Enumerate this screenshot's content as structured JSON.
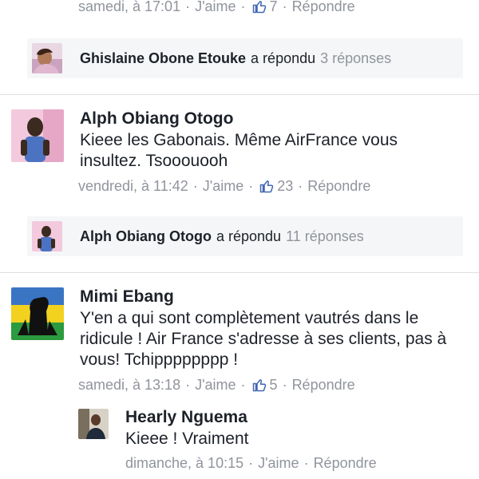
{
  "top_meta": {
    "time": "samedi, à 17:01",
    "like": "J'aime",
    "likes": "7",
    "reply": "Répondre"
  },
  "reply_bar_1": {
    "name": "Ghislaine Obone Etouke",
    "verb": "a répondu",
    "count": "3 réponses"
  },
  "comment_1": {
    "name": "Alph Obiang Otogo",
    "text": "Kieee les Gabonais. Même AirFrance vous insultez. Tsooouooh",
    "time": "vendredi, à 11:42",
    "like": "J'aime",
    "likes": "23",
    "reply": "Répondre"
  },
  "reply_bar_2": {
    "name": "Alph Obiang Otogo",
    "verb": "a répondu",
    "count": "11 réponses"
  },
  "comment_2": {
    "name": "Mimi Ebang",
    "text": "Y'en a qui sont complètement vautrés dans le ridicule ! Air France s'adresse à ses clients, pas à vous! Tchipppppppp !",
    "time": "samedi, à 13:18",
    "like": "J'aime",
    "likes": "5",
    "reply": "Répondre"
  },
  "reply_1": {
    "name": "Hearly Nguema",
    "text": "Kieee ! Vraiment",
    "time": "dimanche, à 10:15",
    "like": "J'aime",
    "reply": "Répondre"
  },
  "colors": {
    "meta_gray": "#90949c",
    "bar_bg": "#f5f6f7",
    "divider": "#dddfe2",
    "like_blue": "#4267b2"
  },
  "icons": [
    "thumbs-up-icon",
    "avatar"
  ]
}
